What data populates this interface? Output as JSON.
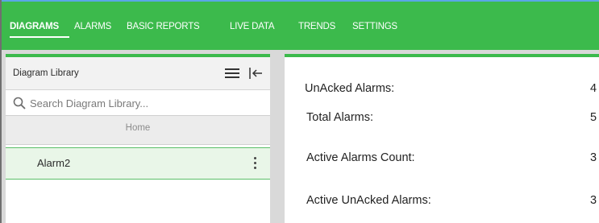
{
  "nav": {
    "items": [
      {
        "label": "DIAGRAMS",
        "active": true
      },
      {
        "label": "ALARMS",
        "active": false
      },
      {
        "label": "BASIC REPORTS",
        "active": false
      },
      {
        "label": "LIVE DATA",
        "active": false
      },
      {
        "label": "TRENDS",
        "active": false
      },
      {
        "label": "SETTINGS",
        "active": false
      }
    ]
  },
  "sidebar": {
    "title": "Diagram Library",
    "menu_icon": "hamburger-menu-icon",
    "collapse_icon": "collapse-left-icon",
    "search": {
      "placeholder": "Search Diagram Library...",
      "value": "",
      "icon": "search-icon"
    },
    "breadcrumb": "Home",
    "items": [
      {
        "label": "Alarm2",
        "selected": true,
        "more_icon": "kebab-menu-icon"
      }
    ]
  },
  "main": {
    "metrics": [
      {
        "label": "UnAcked Alarms:",
        "value": "4"
      },
      {
        "label": "Total Alarms:",
        "value": "5"
      },
      {
        "label": "Active Alarms Count:",
        "value": "3"
      },
      {
        "label": "Active UnAcked Alarms:",
        "value": "3"
      }
    ]
  },
  "colors": {
    "accent": "#3cba4c",
    "selected_row": "#e9f6e8",
    "panel_header": "#f2f2f2",
    "gutter": "#d9d9d9"
  }
}
